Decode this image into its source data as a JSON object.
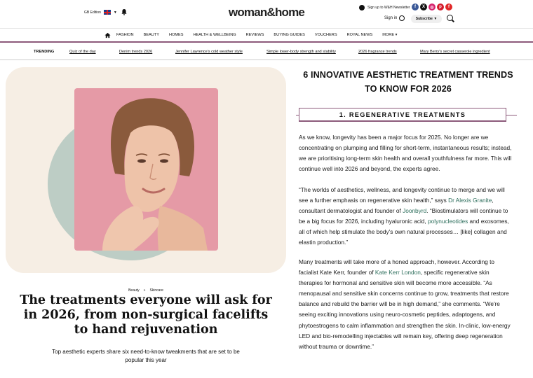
{
  "header": {
    "edition_label": "GB Edition",
    "caret": "▼",
    "logo": "woman&home",
    "newsletter_label": "Sign up to W&H Newsletter",
    "socials": [
      {
        "name": "facebook",
        "glyph": "f",
        "color": "#3b5998"
      },
      {
        "name": "x",
        "glyph": "X",
        "color": "#111111"
      },
      {
        "name": "instagram",
        "glyph": "◎",
        "color": "#d6246e"
      },
      {
        "name": "pinterest",
        "glyph": "p",
        "color": "#d41b2c"
      },
      {
        "name": "flipboard",
        "glyph": "f",
        "color": "#e12828"
      }
    ],
    "signin_label": "Sign in",
    "subscribe_label": "Subscribe",
    "subscribe_caret": "▼"
  },
  "nav": {
    "items": [
      "Fashion",
      "Beauty",
      "Homes",
      "Health & Wellbeing",
      "Reviews",
      "Buying Guides",
      "Vouchers",
      "Royal News",
      "More ▾"
    ]
  },
  "trending": {
    "label": "TRENDING",
    "links": [
      "Quiz of the day",
      "Denim trends 2026",
      "Jennifer Lawrence's cold weather style",
      "Simple lower-body strength and stability",
      "2026 fragrance trends",
      "Mary Berry's secret casserole ingredient"
    ]
  },
  "article": {
    "breadcrumbs": [
      "Beauty",
      "»",
      "Skincare"
    ],
    "headline": "The treatments everyone will ask for in 2026, from non-surgical facelifts to hand rejuvenation",
    "standfirst": "Top aesthetic experts share six need-to-know tweakments that are set to be popular this year"
  },
  "right": {
    "title": "6 INNOVATIVE AESTHETIC TREATMENT TRENDS TO KNOW FOR 2026",
    "section": "1. REGENERATIVE TREATMENTS",
    "p1": "As we know, longevity has been a major focus for 2025. No longer are we concentrating on plumping and filling for short-term, instantaneous results; instead, we are prioritising long-term skin health and overall youthfulness far more. This will continue well into 2026 and beyond, the experts agree.",
    "p2": {
      "a": "“The worlds of aesthetics, wellness, and longevity continue to merge and we will see a further emphasis on regenerative skin health,” says ",
      "link1": "Dr Alexis Granite",
      "b": ", consultant dermatologist and founder of ",
      "link2": "Joonbyrd",
      "c": ". “Biostimulators will continue to be a big focus for 2026, including hyaluronic acid, ",
      "link3": "polynucleotides",
      "d": " and exosomes, all of which help stimulate the body's own natural processes… [like] collagen and elastin production.”"
    },
    "p3": {
      "a": "Many treatments will take more of a honed approach, however. According to facialist Kate Kerr, founder of ",
      "link1": "Kate Kerr London",
      "b": ", specific regenerative skin therapies for hormonal and sensitive skin will become more accessible. “As menopausal and sensitive skin concerns continue to grow, treatments that restore balance and rebuild the barrier will be in high demand,” she comments. “We're seeing exciting innovations using neuro-cosmetic peptides, adaptogens, and phytoestrogens to calm inflammation and strengthen the skin. In-clinic, low-energy LED and bio-remodelling injectables will remain key, offering deep regeneration without trauma or downtime.”"
    }
  },
  "colors": {
    "accent": "#8c5a7b",
    "link": "#2d6e5c",
    "hero_bg": "#f6eee4",
    "blob": "#a9c2bb",
    "photo_bg": "#e59aa6"
  }
}
